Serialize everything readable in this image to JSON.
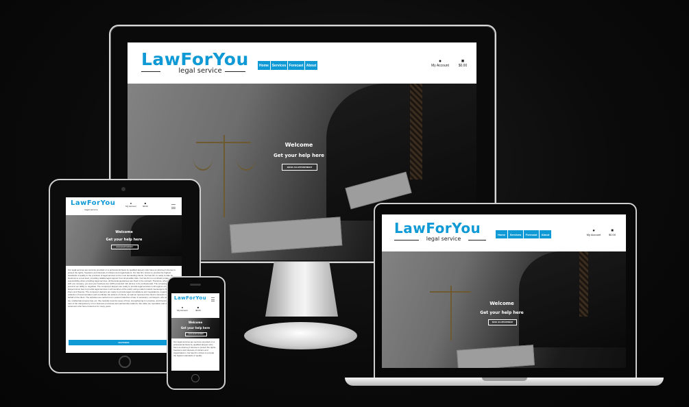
{
  "brand": {
    "name": "LawForYou",
    "tagline": "legal service"
  },
  "nav": [
    "Home",
    "Services",
    "Forecast",
    "About"
  ],
  "account": {
    "label": "My Account",
    "cart_total": "$0.00"
  },
  "hero": {
    "title": "Welcome",
    "subtitle": "Get your help here",
    "cta": "BOOK AN APPOINTMENT"
  },
  "body_text": "Our legal services are services provided on a professional basis by qualified lawyers who have an attorney's license to protect the rights, freedoms and interests of citizens and organizations. Our law firm strives to provide the highest standards of quality in the provision of legal services to the most demanding clients. Our law firm is ready to take its business to a new level, providing reliable legal support from all possible risks. Our law firm is not afraid to take responsibility when providing legal services. All financial guarantees are fixed in the contract. Therefore, when cooperating with our company, you and your business are 100% protected. We all love to be professionals. The company's lawyers are proud of our ability to negotiate. The company's lawyers are ready to provide legal services in all regions of Ukraine. Our lawyers know how to provide legal services in all countries of the world, using modern instant messengers (Skype, Viber, Zoom and Teams). The company's lawyers are ready to provide legal consultations and negotiations, organize the collection of documentation and coordinate the actions of clients, as well as represent the client's interests in court on behalf of the client. The activities are carried out in various branches of law. If necessary, our lawyers, who are civil, labor, tax, intellectual property law, etc. We carefully treat the issue of trust, strengthening it in practice, and therefore we take care of the transparency of our business processes and partnership relations. We value our reputation and regular customers who have trusted us for many years.",
  "phone_text": "Our legal services are services provided on a professional basis by qualified lawyers who have an attorney's license to protect the rights, freedoms and interests of citizens and organizations. Our law firm strives to provide the highest standards of quality",
  "features_button": "FEATURES",
  "colors": {
    "accent": "#0f9ad6",
    "background": "#0b0b0b"
  }
}
